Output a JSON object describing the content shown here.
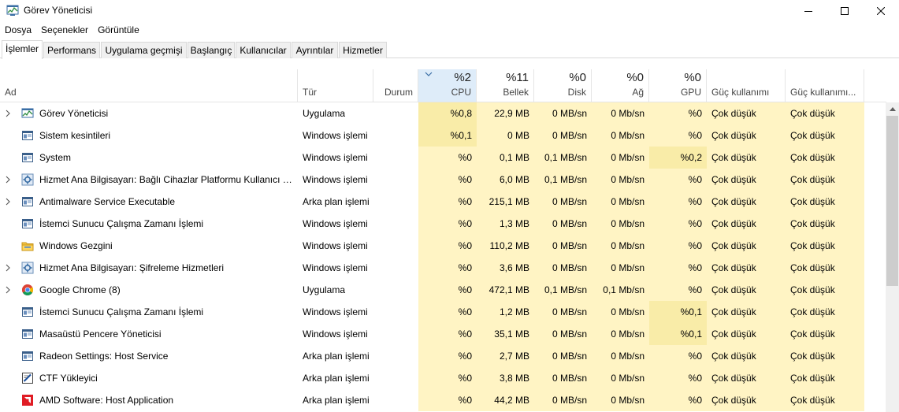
{
  "window": {
    "title": "Görev Yöneticisi"
  },
  "menu": [
    "Dosya",
    "Seçenekler",
    "Görüntüle"
  ],
  "tabs": [
    "İşlemler",
    "Performans",
    "Uygulama geçmişi",
    "Başlangıç",
    "Kullanıcılar",
    "Ayrıntılar",
    "Hizmetler"
  ],
  "active_tab": "İşlemler",
  "columns": {
    "name": "Ad",
    "type": "Tür",
    "status": "Durum",
    "cpu": {
      "pct": "%2",
      "label": "CPU"
    },
    "memory": {
      "pct": "%11",
      "label": "Bellek"
    },
    "disk": {
      "pct": "%0",
      "label": "Disk"
    },
    "network": {
      "pct": "%0",
      "label": "Ağ"
    },
    "gpu": {
      "pct": "%0",
      "label": "GPU"
    },
    "power": "Güç kullanımı",
    "power_trend": "Güç kullanımı..."
  },
  "colors": {
    "cell_light": "#fff4c4",
    "cell_medium": "#f9eca8",
    "sorted_header": "#deecf9"
  },
  "processes": [
    {
      "name": "Görev Yöneticisi",
      "icon": "task-manager-icon",
      "expandable": true,
      "type": "Uygulama",
      "status": "",
      "cpu": "%0,8",
      "memory": "22,9 MB",
      "disk": "0 MB/sn",
      "network": "0 Mb/sn",
      "gpu": "%0",
      "power": "Çok düşük",
      "power_trend": "Çok düşük",
      "cpu_hl": true,
      "gpu_hl": false
    },
    {
      "name": "Sistem kesintileri",
      "icon": "system-process-icon",
      "expandable": false,
      "type": "Windows işlemi",
      "status": "",
      "cpu": "%0,1",
      "memory": "0 MB",
      "disk": "0 MB/sn",
      "network": "0 Mb/sn",
      "gpu": "%0",
      "power": "Çok düşük",
      "power_trend": "Çok düşük",
      "cpu_hl": true,
      "gpu_hl": false
    },
    {
      "name": "System",
      "icon": "system-process-icon",
      "expandable": false,
      "type": "Windows işlemi",
      "status": "",
      "cpu": "%0",
      "memory": "0,1 MB",
      "disk": "0,1 MB/sn",
      "network": "0 Mb/sn",
      "gpu": "%0,2",
      "power": "Çok düşük",
      "power_trend": "Çok düşük",
      "cpu_hl": false,
      "gpu_hl": true
    },
    {
      "name": "Hizmet Ana Bilgisayarı: Bağlı Cihazlar Platformu Kullanıcı H...",
      "icon": "gear-icon",
      "expandable": true,
      "type": "Windows işlemi",
      "status": "",
      "cpu": "%0",
      "memory": "6,0 MB",
      "disk": "0,1 MB/sn",
      "network": "0 Mb/sn",
      "gpu": "%0",
      "power": "Çok düşük",
      "power_trend": "Çok düşük",
      "cpu_hl": false,
      "gpu_hl": false
    },
    {
      "name": "Antimalware Service Executable",
      "icon": "system-process-icon",
      "expandable": true,
      "type": "Arka plan işlemi",
      "status": "",
      "cpu": "%0",
      "memory": "215,1 MB",
      "disk": "0 MB/sn",
      "network": "0 Mb/sn",
      "gpu": "%0",
      "power": "Çok düşük",
      "power_trend": "Çok düşük",
      "cpu_hl": false,
      "gpu_hl": false
    },
    {
      "name": "İstemci Sunucu Çalışma Zamanı İşlemi",
      "icon": "system-process-icon",
      "expandable": false,
      "type": "Windows işlemi",
      "status": "",
      "cpu": "%0",
      "memory": "1,3 MB",
      "disk": "0 MB/sn",
      "network": "0 Mb/sn",
      "gpu": "%0",
      "power": "Çok düşük",
      "power_trend": "Çok düşük",
      "cpu_hl": false,
      "gpu_hl": false
    },
    {
      "name": "Windows Gezgini",
      "icon": "folder-icon",
      "expandable": false,
      "type": "Windows işlemi",
      "status": "",
      "cpu": "%0",
      "memory": "110,2 MB",
      "disk": "0 MB/sn",
      "network": "0 Mb/sn",
      "gpu": "%0",
      "power": "Çok düşük",
      "power_trend": "Çok düşük",
      "cpu_hl": false,
      "gpu_hl": false
    },
    {
      "name": "Hizmet Ana Bilgisayarı: Şifreleme Hizmetleri",
      "icon": "gear-icon",
      "expandable": true,
      "type": "Windows işlemi",
      "status": "",
      "cpu": "%0",
      "memory": "3,6 MB",
      "disk": "0 MB/sn",
      "network": "0 Mb/sn",
      "gpu": "%0",
      "power": "Çok düşük",
      "power_trend": "Çok düşük",
      "cpu_hl": false,
      "gpu_hl": false
    },
    {
      "name": "Google Chrome (8)",
      "icon": "chrome-icon",
      "expandable": true,
      "type": "Uygulama",
      "status": "",
      "cpu": "%0",
      "memory": "472,1 MB",
      "disk": "0,1 MB/sn",
      "network": "0,1 Mb/sn",
      "gpu": "%0",
      "power": "Çok düşük",
      "power_trend": "Çok düşük",
      "cpu_hl": false,
      "gpu_hl": false
    },
    {
      "name": "İstemci Sunucu Çalışma Zamanı İşlemi",
      "icon": "system-process-icon",
      "expandable": false,
      "type": "Windows işlemi",
      "status": "",
      "cpu": "%0",
      "memory": "1,2 MB",
      "disk": "0 MB/sn",
      "network": "0 Mb/sn",
      "gpu": "%0,1",
      "power": "Çok düşük",
      "power_trend": "Çok düşük",
      "cpu_hl": false,
      "gpu_hl": true
    },
    {
      "name": "Masaüstü Pencere Yöneticisi",
      "icon": "system-process-icon",
      "expandable": false,
      "type": "Windows işlemi",
      "status": "",
      "cpu": "%0",
      "memory": "35,1 MB",
      "disk": "0 MB/sn",
      "network": "0 Mb/sn",
      "gpu": "%0,1",
      "power": "Çok düşük",
      "power_trend": "Çok düşük",
      "cpu_hl": false,
      "gpu_hl": true
    },
    {
      "name": "Radeon Settings: Host Service",
      "icon": "system-process-icon",
      "expandable": false,
      "type": "Arka plan işlemi",
      "status": "",
      "cpu": "%0",
      "memory": "2,7 MB",
      "disk": "0 MB/sn",
      "network": "0 Mb/sn",
      "gpu": "%0",
      "power": "Çok düşük",
      "power_trend": "Çok düşük",
      "cpu_hl": false,
      "gpu_hl": false
    },
    {
      "name": "CTF Yükleyici",
      "icon": "ctf-loader-icon",
      "expandable": false,
      "type": "Arka plan işlemi",
      "status": "",
      "cpu": "%0",
      "memory": "3,8 MB",
      "disk": "0 MB/sn",
      "network": "0 Mb/sn",
      "gpu": "%0",
      "power": "Çok düşük",
      "power_trend": "Çok düşük",
      "cpu_hl": false,
      "gpu_hl": false
    },
    {
      "name": "AMD Software: Host Application",
      "icon": "amd-icon",
      "expandable": false,
      "type": "Arka plan işlemi",
      "status": "",
      "cpu": "%0",
      "memory": "44,2 MB",
      "disk": "0 MB/sn",
      "network": "0 Mb/sn",
      "gpu": "%0",
      "power": "Çok düşük",
      "power_trend": "Çok düşük",
      "cpu_hl": false,
      "gpu_hl": false
    }
  ]
}
